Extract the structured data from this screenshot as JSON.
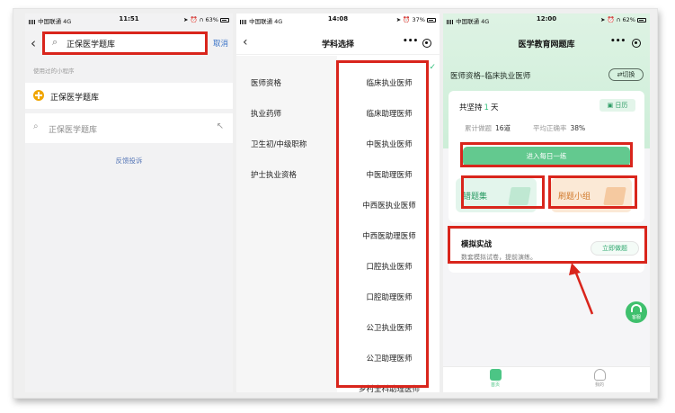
{
  "panel1": {
    "status": {
      "carrier": "中国联通 4G",
      "time": "11:51",
      "battery": "63%"
    },
    "search": {
      "value": "正保医学题库",
      "cancel_label": "取消"
    },
    "recent_label": "使用过的小程序",
    "recent_item": "正保医学题库",
    "suggestion": "正保医学题库",
    "feedback": "反馈投诉"
  },
  "panel2": {
    "status": {
      "carrier": "中国联通 4G",
      "time": "14:08",
      "battery": "37%"
    },
    "title": "学科选择",
    "categories": [
      "医师资格",
      "执业药师",
      "卫生初/中级职称",
      "护士执业资格"
    ],
    "subjects": [
      "临床执业医师",
      "临床助理医师",
      "中医执业医师",
      "中医助理医师",
      "中西医执业医师",
      "中西医助理医师",
      "口腔执业医师",
      "口腔助理医师",
      "公卫执业医师",
      "公卫助理医师",
      "乡村全科助理医师"
    ]
  },
  "panel3": {
    "status": {
      "carrier": "中国联通 4G",
      "time": "12:00",
      "battery": "62%"
    },
    "title": "医学教育网题库",
    "subject": "医师资格–临床执业医师",
    "switch_label": "⇄切换",
    "persist_prefix": "共坚持",
    "persist_days": "1",
    "persist_suffix": "天",
    "calendar_label": "日历",
    "stat_done_label": "累计做题",
    "stat_done_value": "16道",
    "stat_rate_label": "平均正确率",
    "stat_rate_value": "38%",
    "daily_practice": "进入每日一练",
    "wrong_book": "错题集",
    "drill_group": "刷题小组",
    "mock_title": "模拟实战",
    "mock_desc": "数套模拟试卷，提前演练。",
    "mock_button": "立即做题",
    "support_label": "客服",
    "tabs": {
      "home": "首页",
      "mine": "我的"
    }
  },
  "colors": {
    "highlight": "#d9251c",
    "accent_green": "#2fbf7a",
    "link_blue": "#3a73c7"
  },
  "icons": [
    "search-icon",
    "back-chevron-icon",
    "more-dots-icon",
    "target-icon",
    "calendar-icon",
    "headset-icon",
    "home-icon",
    "profile-icon"
  ]
}
